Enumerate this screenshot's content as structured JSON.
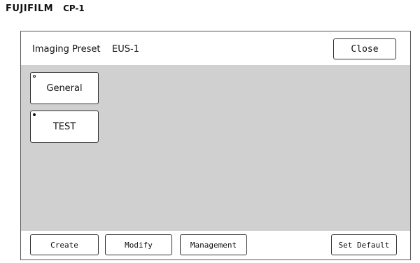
{
  "brand": {
    "logo": "FUJIFILM",
    "model": "CP-1"
  },
  "header": {
    "title_label": "Imaging Preset",
    "title_value": "EUS-1",
    "close_label": "Close"
  },
  "presets": [
    {
      "label": "General",
      "indicator": "open"
    },
    {
      "label": "TEST",
      "indicator": "filled"
    }
  ],
  "footer": {
    "create_label": "Create",
    "modify_label": "Modify",
    "management_label": "Management",
    "set_default_label": "Set Default"
  },
  "colors": {
    "content_background": "#d0d0d0",
    "border": "#333333"
  }
}
